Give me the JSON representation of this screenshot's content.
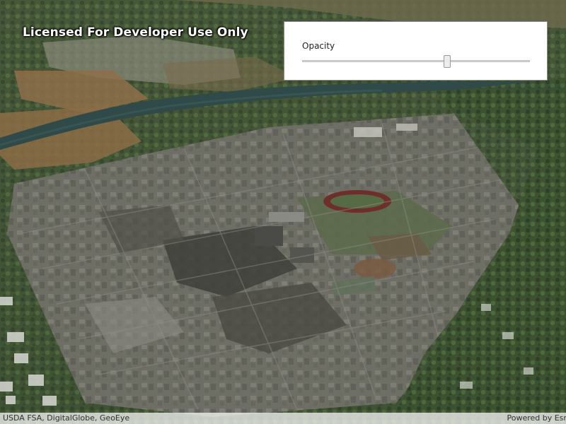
{
  "map": {
    "license_text": "Licensed For Developer Use Only",
    "attribution": "USDA FSA, DigitalGlobe, GeoEye",
    "powered_by": "Powered by Esri"
  },
  "opacity_panel": {
    "label": "Opacity",
    "slider_value": 0.64
  }
}
